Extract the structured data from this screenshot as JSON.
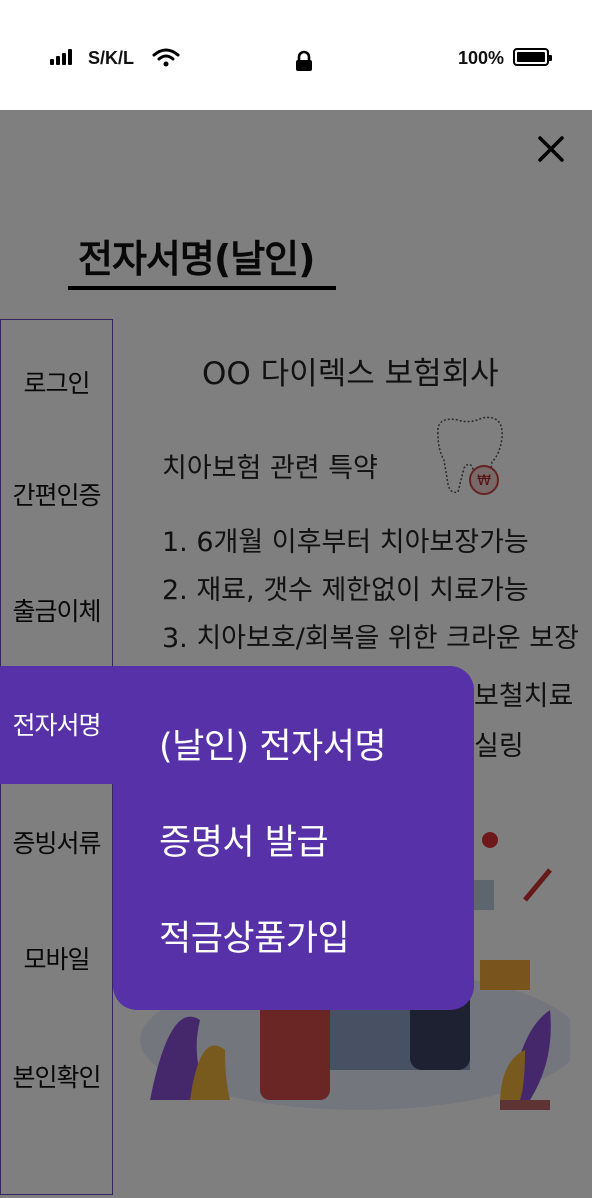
{
  "status_bar": {
    "carrier": "S/K/L",
    "battery": "100%"
  },
  "page": {
    "title": "전자서명(날인)"
  },
  "sidebar": {
    "items": [
      {
        "label": "로그인"
      },
      {
        "label": "간편인증"
      },
      {
        "label": "출금이체"
      },
      {
        "label": "전자서명"
      },
      {
        "label": "증빙서류"
      },
      {
        "label": "모바일"
      },
      {
        "label": "본인확인"
      }
    ],
    "active_index": 3
  },
  "document": {
    "company": "OO 다이렉스 보험회사",
    "subtitle": "치아보험 관련 특약",
    "lines": [
      "1. 6개월 이후부터 치아보장가능",
      "2. 재료, 갯수 제한없이 치료가능",
      "3. 치아보호/회복을 위한 크라운 보장",
      "보철치료",
      "실링"
    ]
  },
  "submenu": {
    "items": [
      {
        "label": "(날인) 전자서명"
      },
      {
        "label": "증명서 발급"
      },
      {
        "label": "적금상품가입"
      }
    ]
  },
  "colors": {
    "accent": "#5631a7",
    "overlay": "rgba(0,0,0,0.5)",
    "nav_border": "#6a4bc2"
  },
  "icons": [
    "signal-icon",
    "wifi-icon",
    "lock-icon",
    "battery-icon",
    "close-icon",
    "tooth-icon"
  ]
}
